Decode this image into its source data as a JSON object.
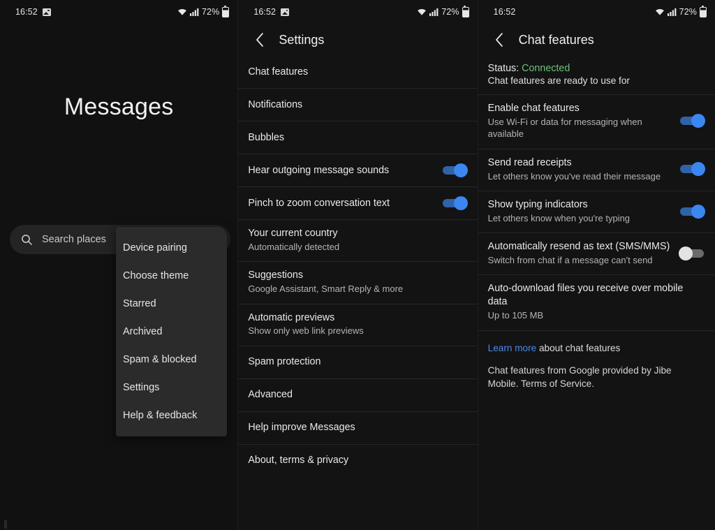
{
  "statusbar": {
    "time": "16:52",
    "battery_pct": "72%",
    "icons": [
      "image-icon",
      "wifi-icon",
      "signal-icon",
      "battery-icon"
    ]
  },
  "panel_messages": {
    "app_title": "Messages",
    "search": {
      "placeholder": "Search places",
      "icon": "search-icon"
    },
    "overflow_menu": {
      "items": [
        {
          "label": "Device pairing"
        },
        {
          "label": "Choose theme"
        },
        {
          "label": "Starred"
        },
        {
          "label": "Archived"
        },
        {
          "label": "Spam & blocked"
        },
        {
          "label": "Settings"
        },
        {
          "label": "Help & feedback"
        }
      ]
    }
  },
  "panel_settings": {
    "appbar": {
      "title": "Settings",
      "back_icon": "chevron-left-icon"
    },
    "rows": [
      {
        "title": "Chat features",
        "sub": "",
        "toggle": null
      },
      {
        "title": "Notifications",
        "sub": "",
        "toggle": null
      },
      {
        "title": "Bubbles",
        "sub": "",
        "toggle": null
      },
      {
        "title": "Hear outgoing message sounds",
        "sub": "",
        "toggle": "on"
      },
      {
        "title": "Pinch to zoom conversation text",
        "sub": "",
        "toggle": "on"
      },
      {
        "title": "Your current country",
        "sub": "Automatically detected",
        "toggle": null
      },
      {
        "title": "Suggestions",
        "sub": "Google Assistant, Smart Reply & more",
        "toggle": null
      },
      {
        "title": "Automatic previews",
        "sub": "Show only web link previews",
        "toggle": null
      },
      {
        "title": "Spam protection",
        "sub": "",
        "toggle": null
      },
      {
        "title": "Advanced",
        "sub": "",
        "toggle": null
      },
      {
        "title": "Help improve Messages",
        "sub": "",
        "toggle": null
      },
      {
        "title": "About, terms & privacy",
        "sub": "",
        "toggle": null
      }
    ]
  },
  "panel_chat_features": {
    "appbar": {
      "title": "Chat features",
      "back_icon": "chevron-left-icon"
    },
    "status": {
      "label": "Status:",
      "value": "Connected",
      "value_color": "#6fbf7c",
      "sub": "Chat features are ready to use for"
    },
    "rows": [
      {
        "title": "Enable chat features",
        "sub": "Use Wi-Fi or data for messaging when available",
        "toggle": "on"
      },
      {
        "title": "Send read receipts",
        "sub": "Let others know you've read their message",
        "toggle": "on"
      },
      {
        "title": "Show typing indicators",
        "sub": "Let others know when you're typing",
        "toggle": "on"
      },
      {
        "title": "Automatically resend as text (SMS/MMS)",
        "sub": "Switch from chat if a message can't send",
        "toggle": "off"
      },
      {
        "title": "Auto-download files you receive over mobile data",
        "sub": "Up to 105 MB",
        "toggle": null
      }
    ],
    "footer": {
      "link_text": "Learn more",
      "link_rest": " about chat features",
      "link_color": "#4c88e8",
      "note": "Chat features from Google provided by Jibe Mobile. Terms of Service."
    }
  }
}
